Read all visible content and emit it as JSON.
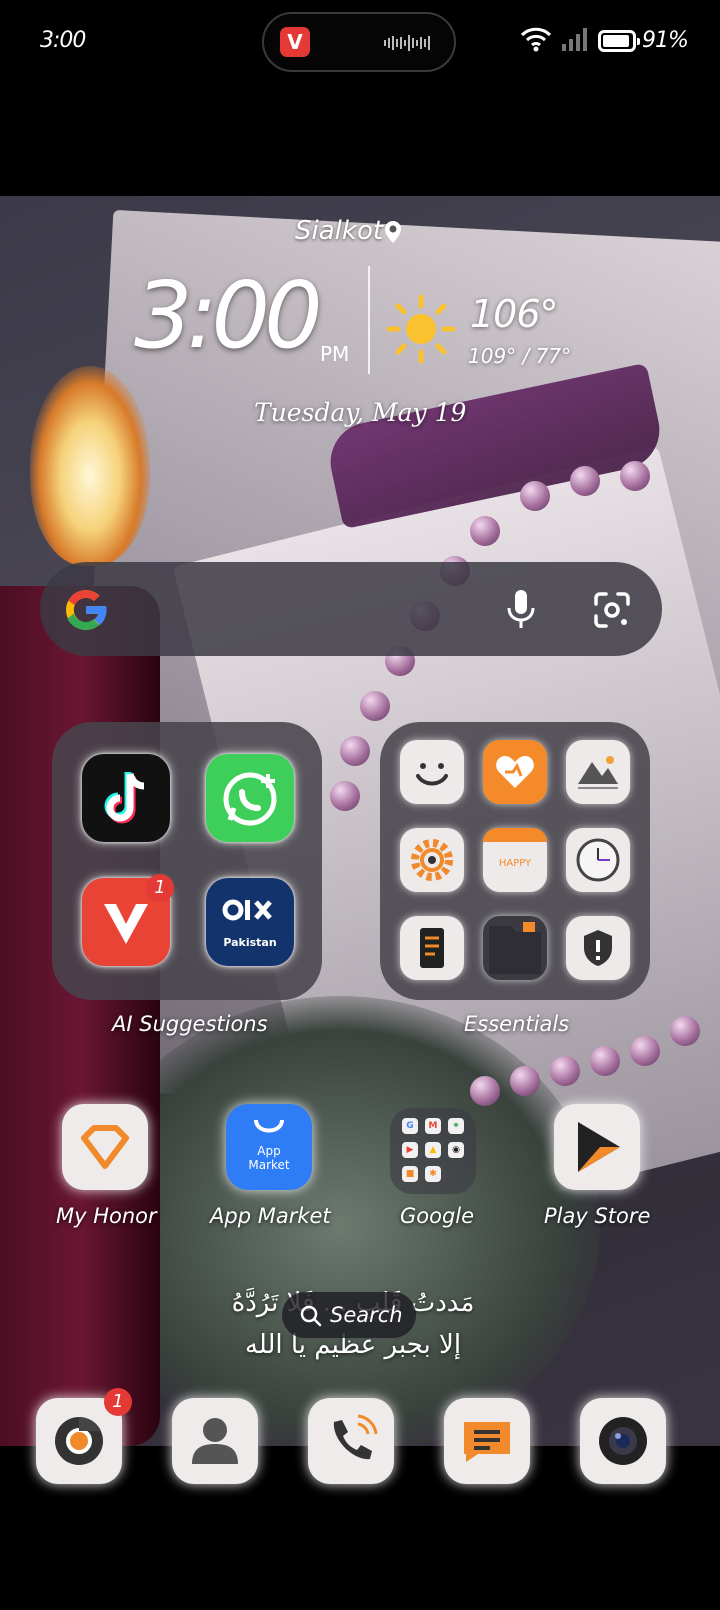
{
  "status_bar": {
    "time": "3:00",
    "battery": "91%"
  },
  "clock_widget": {
    "location": "Sialkot",
    "time": "3:00",
    "ampm": "PM",
    "temperature": "106°",
    "temp_range": "109° / 77°",
    "date": "Tuesday, May 19"
  },
  "folders": {
    "ai_suggestions": {
      "label": "AI Suggestions",
      "apps": [
        "TikTok",
        "WhatsApp Business",
        "Video Downloader",
        "OLX Pakistan"
      ],
      "badge": "1",
      "olx_text": "Pakistan"
    },
    "essentials": {
      "label": "Essentials",
      "happy_text": "HAPPY"
    }
  },
  "home_row": {
    "my_honor": "My Honor",
    "app_market": "App Market",
    "app_market_icon_text": "App Market",
    "google": "Google",
    "play_store": "Play Store"
  },
  "arabic_text": {
    "line1": "مَددتُ قَلبِ ... فَلا تَرُدَّهُ",
    "line2": "إلا بجبر عظيم يا الله"
  },
  "search_pill": {
    "label": "Search"
  },
  "dock": {
    "browser_badge": "1"
  }
}
